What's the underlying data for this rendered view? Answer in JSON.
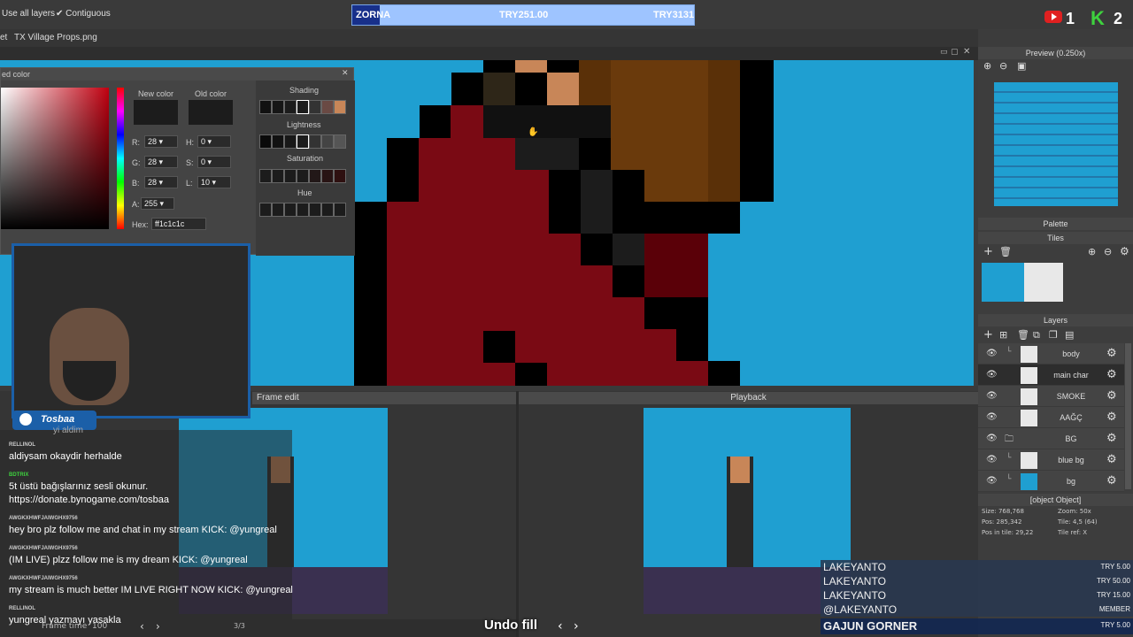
{
  "toolbar": {
    "use_all_layers": "Use all layers",
    "contiguous": "Contiguous"
  },
  "donation_bar": {
    "name": "ZORNA",
    "amount": "TRY251.00",
    "goal": "TRY3131",
    "progress": 0.08
  },
  "badges": {
    "youtube_count": "1",
    "kick_count": "2"
  },
  "tabs": {
    "prev_fragment": "et",
    "file_tab": "TX Village Props.png"
  },
  "color_picker": {
    "title": "ed color",
    "new_color": "New color",
    "old_color": "Old color",
    "r_label": "R:",
    "r": "28",
    "g_label": "G:",
    "g": "28",
    "b_label": "B:",
    "b": "28",
    "a_label": "A:",
    "a": "255",
    "h_label": "H:",
    "h": "0",
    "s_label": "S:",
    "s": "0",
    "l_label": "L:",
    "l": "10",
    "hex_label": "Hex:",
    "hex": "ff1c1c1c",
    "shading": "Shading",
    "lightness": "Lightness",
    "saturation": "Saturation",
    "hue": "Hue",
    "swatch_color": "#1c1c1c"
  },
  "panels": {
    "frame_edit": "Frame edit",
    "playback": "Playback",
    "frame_time_label": "Frame time",
    "frame_time": "100",
    "frame_counter": "3/3"
  },
  "right_panel": {
    "preview": "Preview (0.250x)",
    "palette": "Palette",
    "tiles": "Tiles",
    "layers": "Layers",
    "info": {
      "size": "Size: 768,768",
      "zoom": "Zoom: 50x",
      "pos": "Pos: 285,342",
      "tile": "Tile: 4,5 (64)",
      "pos_in_tile": "Pos in tile: 29,22",
      "tile_ref": "Tile ref: X"
    },
    "layers_list": [
      {
        "name": "body",
        "thumb": "#e8e8e8"
      },
      {
        "name": "main char",
        "thumb": "#e8e8e8"
      },
      {
        "name": "SMOKE",
        "thumb": "#e8e8e8"
      },
      {
        "name": "AAĞÇ",
        "thumb": "#e8e8e8"
      },
      {
        "name": "BG",
        "thumb": ""
      },
      {
        "name": "blue bg",
        "thumb": "#e8e8e8"
      },
      {
        "name": "bg",
        "thumb": "#1f9fd1"
      }
    ]
  },
  "overlay": {
    "streamer": "Tosbaa",
    "status": "Undo fill"
  },
  "chat": [
    {
      "name": "",
      "msg": "yi aldim"
    },
    {
      "name": "RELLINOL",
      "msg": "aldiysam okaydir herhalde"
    },
    {
      "name": "BDTRIX",
      "msg": "5t üstü bağışlarınız sesli okunur."
    },
    {
      "name": "",
      "msg": "https://donate.bynogame.com/tosbaa"
    },
    {
      "name": "AWGKXHWFJAIWGHX9756",
      "msg": "hey bro plz follow me and chat in my stream KICK: @yungreal"
    },
    {
      "name": "AWGKXHWFJAIWGHX9756",
      "msg": "(IM LIVE) plzz follow me is my dream KICK: @yungreal"
    },
    {
      "name": "AWGKXHWFJAIWGHX9756",
      "msg": "my stream is much better IM LIVE RIGHT NOW KICK: @yungreal"
    },
    {
      "name": "RELLINOL",
      "msg": "yungreal yazmayı yasakla"
    }
  ],
  "supporters": [
    {
      "name": "LAKEYANTO",
      "value": "TRY 5.00"
    },
    {
      "name": "LAKEYANTO",
      "value": "TRY 50.00"
    },
    {
      "name": "LAKEYANTO",
      "value": "TRY 15.00"
    },
    {
      "name": "@LAKEYANTO",
      "value": "MEMBER"
    },
    {
      "name": "GAJUN GORNER",
      "value": "TRY 5.00"
    }
  ],
  "colors": {
    "sky": "#1f9fd1",
    "cape": "#7a0a14",
    "accent": "#1b5fa8"
  }
}
